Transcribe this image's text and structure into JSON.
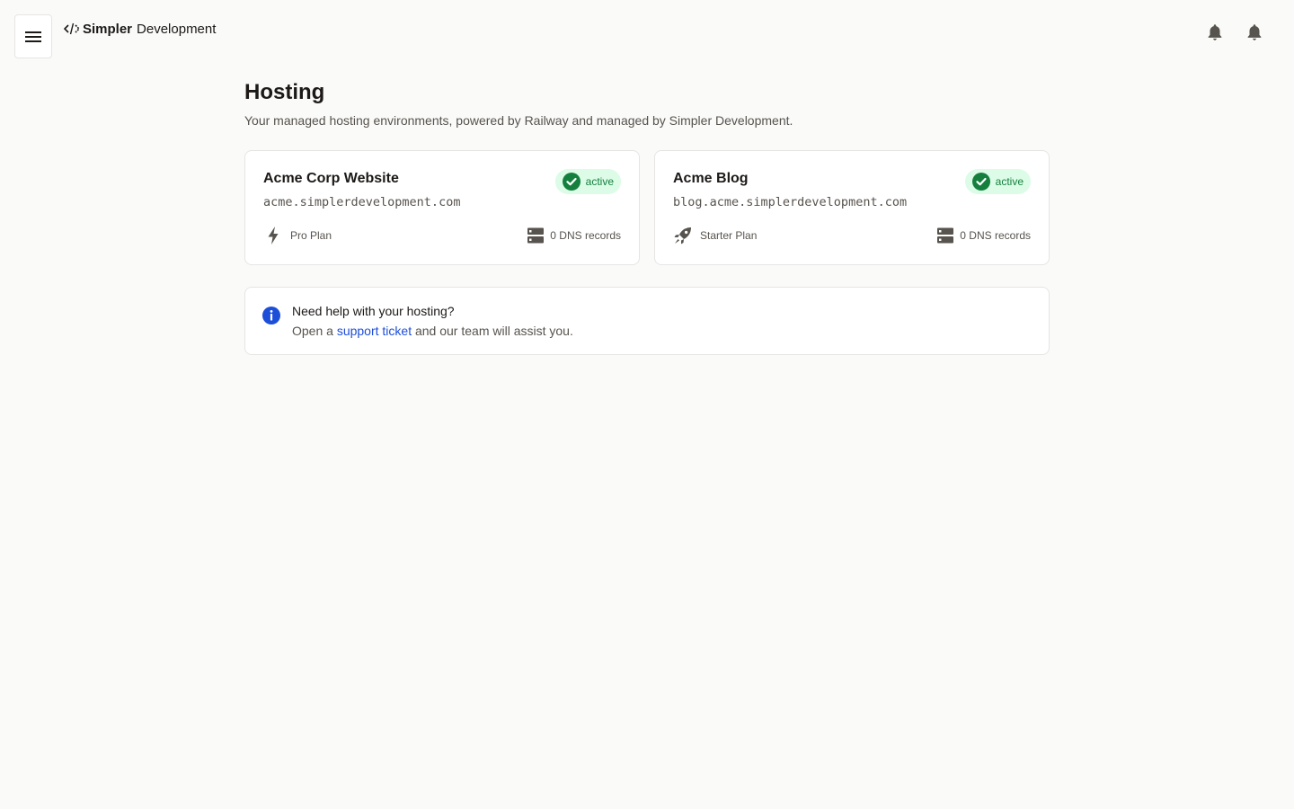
{
  "header": {
    "brand_strong": "Simpler",
    "brand_light": "Development",
    "menu_icon": "hamburger-menu-icon",
    "brand_icon": "code-icon",
    "notification_icons": [
      "bell-icon",
      "bell-icon"
    ]
  },
  "page": {
    "title": "Hosting",
    "subtitle": "Your managed hosting environments, powered by Railway and managed by Simpler Development."
  },
  "environments": [
    {
      "name": "Acme Corp Website",
      "domain": "acme.simplerdevelopment.com",
      "status": "active",
      "status_icon": "check-circle-icon",
      "plan": "Pro Plan",
      "plan_icon": "lightning-icon",
      "dns": "0 DNS records",
      "dns_icon": "server-icon"
    },
    {
      "name": "Acme Blog",
      "domain": "blog.acme.simplerdevelopment.com",
      "status": "active",
      "status_icon": "check-circle-icon",
      "plan": "Starter Plan",
      "plan_icon": "rocket-icon",
      "dns": "0 DNS records",
      "dns_icon": "server-icon"
    }
  ],
  "help": {
    "icon": "info-icon",
    "title": "Need help with your hosting?",
    "text_before": "Open a",
    "link": "support ticket",
    "text_after": "and our team will assist you."
  },
  "colors": {
    "background": "#fafaf9",
    "accent_blue": "#1d4ed8",
    "status_green": "#15803d",
    "status_bg": "#dcfce7",
    "icon_gray": "#57534e"
  }
}
